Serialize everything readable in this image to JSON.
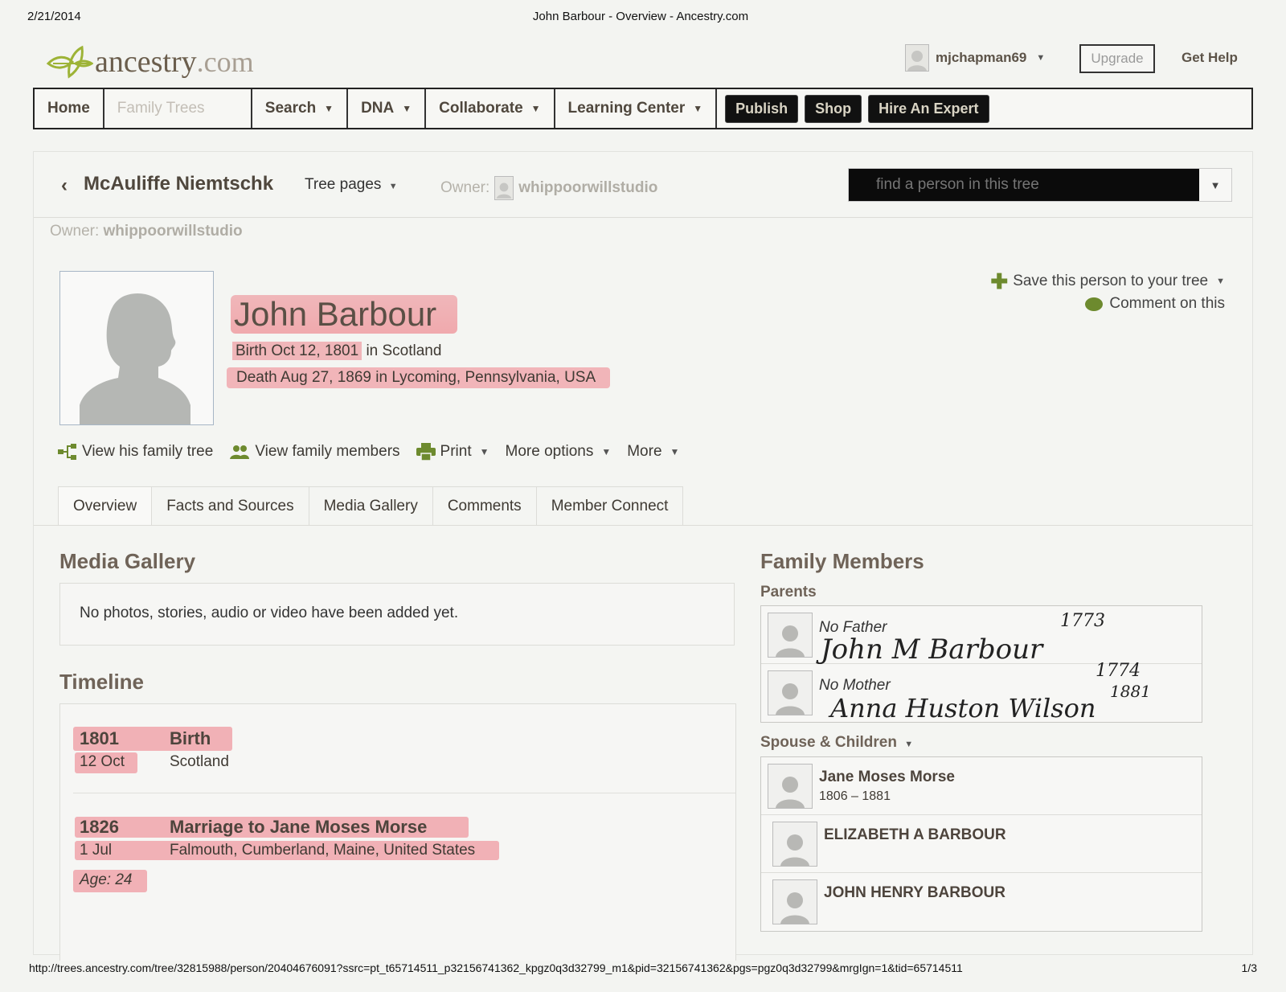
{
  "print": {
    "date": "2/21/2014",
    "title": "John Barbour - Overview - Ancestry.com",
    "url": "http://trees.ancestry.com/tree/32815988/person/20404676091?ssrc=pt_t65714511_p32156741362_kpgz0q3d32799_m1&pid=32156741362&pgs=pgz0q3d32799&mrgIgn=1&tid=65714511",
    "page": "1/3"
  },
  "header": {
    "logo_word": "ancestry",
    "logo_dot": ".com",
    "username": "mjchapman69",
    "upgrade": "Upgrade",
    "get_help": "Get Help"
  },
  "nav": {
    "home": "Home",
    "family_trees": "Family Trees",
    "search": "Search",
    "dna": "DNA",
    "collaborate": "Collaborate",
    "learning_center": "Learning Center",
    "publish": "Publish",
    "shop": "Shop",
    "hire_expert": "Hire An Expert"
  },
  "tree": {
    "name": "McAuliffe Niemtschk",
    "pages_label": "Tree pages",
    "owner_label": "Owner:",
    "owner_name": "whippoorwillstudio",
    "find_placeholder": "find a person in this tree"
  },
  "person": {
    "name": "John Barbour",
    "birth_prefix": "Birth Oct 12, 1801",
    "birth_suffix": "in Scotland",
    "death": "Death Aug 27, 1869 in Lycoming, Pennsylvania, USA",
    "save_link": "Save this person to your tree",
    "comment_link": "Comment on this"
  },
  "actions": {
    "view_tree": "View his family tree",
    "view_members": "View family members",
    "print": "Print",
    "more_options": "More options",
    "more": "More"
  },
  "tabs": [
    "Overview",
    "Facts and Sources",
    "Media Gallery",
    "Comments",
    "Member Connect"
  ],
  "media": {
    "title": "Media Gallery",
    "empty": "No photos, stories, audio or video have been added yet."
  },
  "timeline": {
    "title": "Timeline",
    "events": [
      {
        "year": "1801",
        "day": "12 Oct",
        "event": "Birth",
        "place": "Scotland"
      },
      {
        "year": "1826",
        "day": "1 Jul",
        "event": "Marriage to Jane Moses Morse",
        "place": "Falmouth, Cumberland, Maine, United States",
        "age": "Age: 24"
      }
    ]
  },
  "family": {
    "title": "Family Members",
    "parents_label": "Parents",
    "father_label": "No Father",
    "father_hand": "John M Barbour",
    "father_hand_year": "1773",
    "mother_label": "No Mother",
    "mother_hand": "Anna Huston Wilson",
    "mother_hand_year1": "1774",
    "mother_hand_year2": "1881",
    "spouse_label": "Spouse & Children",
    "members": [
      {
        "name": "Jane Moses Morse",
        "dates": "1806 – 1881"
      },
      {
        "name": "ELIZABETH A BARBOUR",
        "dates": ""
      },
      {
        "name": "JOHN HENRY BARBOUR",
        "dates": ""
      }
    ]
  }
}
